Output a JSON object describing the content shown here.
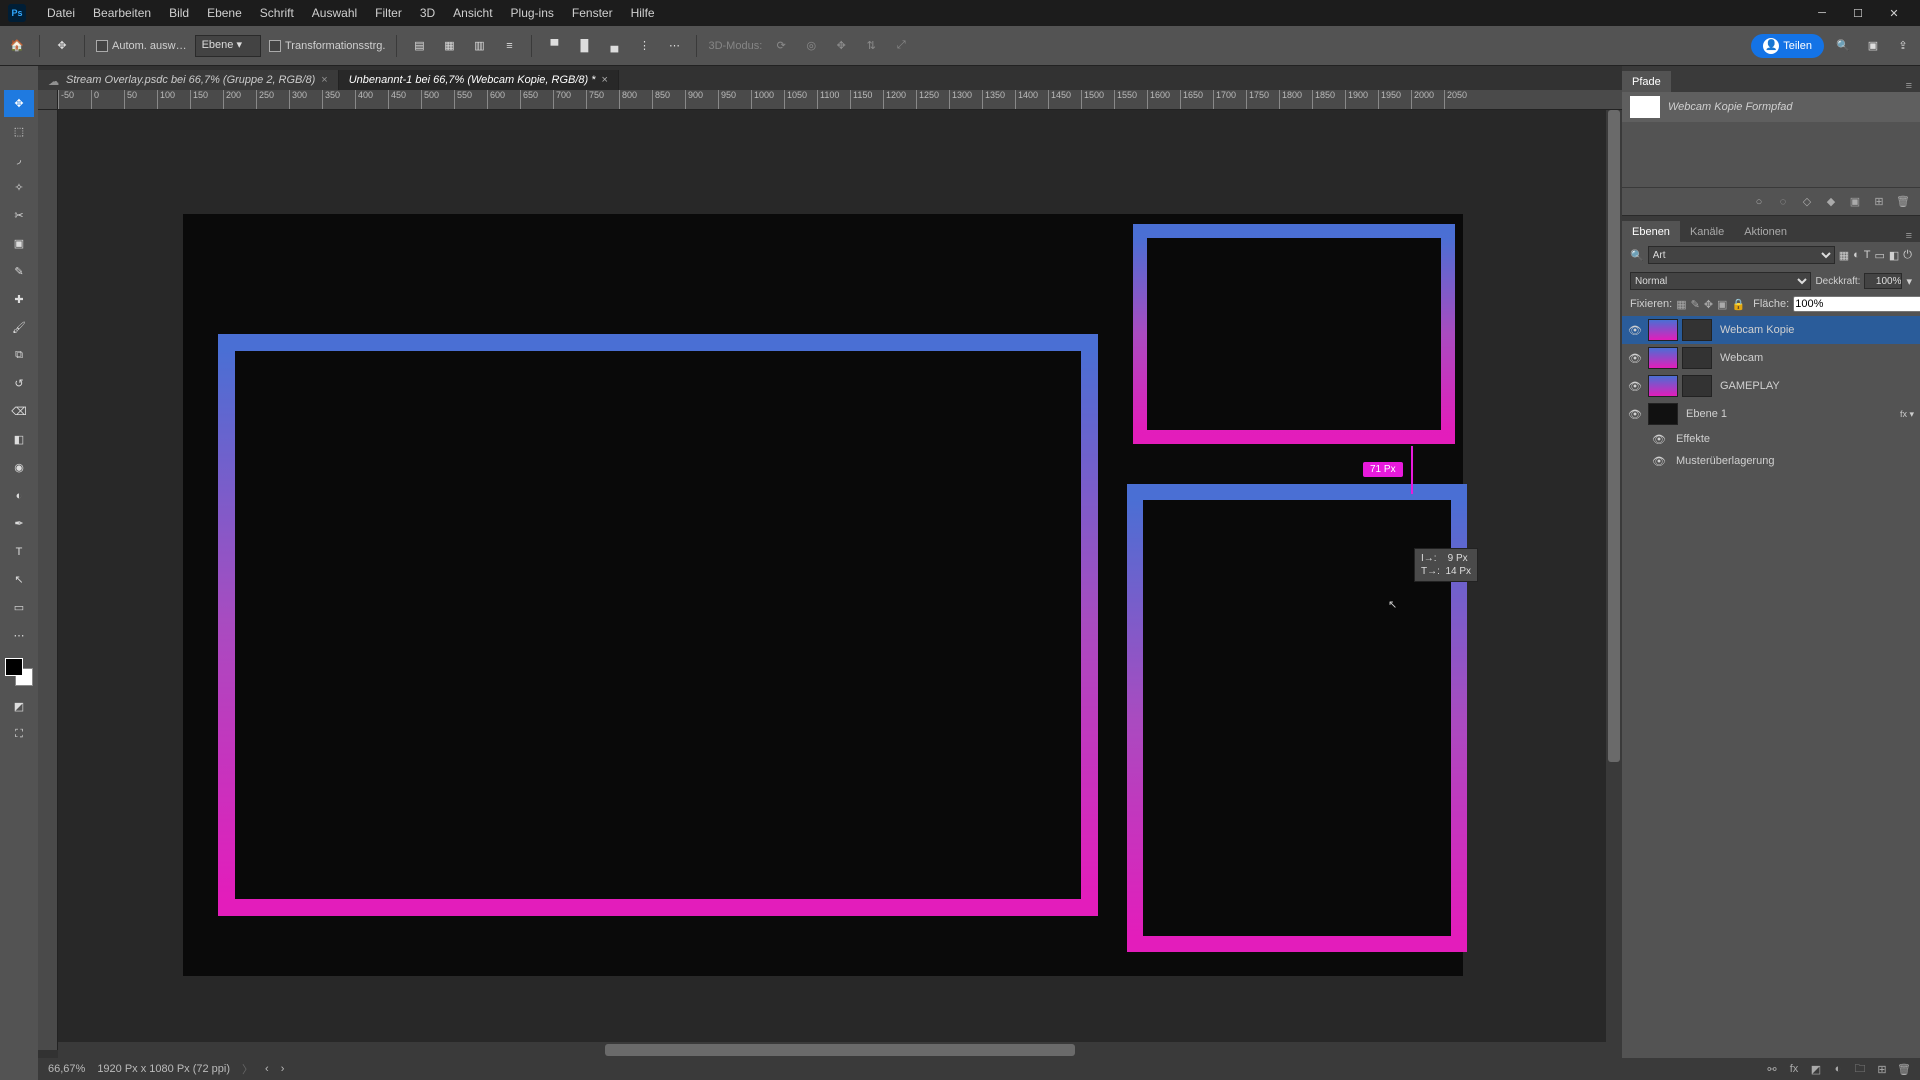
{
  "app": {
    "logo": "Ps"
  },
  "menu": [
    "Datei",
    "Bearbeiten",
    "Bild",
    "Ebene",
    "Schrift",
    "Auswahl",
    "Filter",
    "3D",
    "Ansicht",
    "Plug-ins",
    "Fenster",
    "Hilfe"
  ],
  "options": {
    "auto_select_label": "Autom. ausw…",
    "target_dropdown": "Ebene",
    "transform_label": "Transformationsstrg.",
    "mode_3d": "3D-Modus:",
    "share_label": "Teilen"
  },
  "tabs": [
    {
      "title": "Stream Overlay.psdc bei 66,7% (Gruppe 2, RGB/8)",
      "active": false,
      "cloud": true
    },
    {
      "title": "Unbenannt-1 bei 66,7% (Webcam Kopie, RGB/8) *",
      "active": true,
      "cloud": false
    }
  ],
  "ruler_values": [
    "-50",
    "0",
    "50",
    "100",
    "150",
    "200",
    "250",
    "300",
    "350",
    "400",
    "450",
    "500",
    "550",
    "600",
    "650",
    "700",
    "750",
    "800",
    "850",
    "900",
    "950",
    "1000",
    "1050",
    "1100",
    "1150",
    "1200",
    "1250",
    "1300",
    "1350",
    "1400",
    "1450",
    "1500",
    "1550",
    "1600",
    "1650",
    "1700",
    "1750",
    "1800",
    "1850",
    "1900",
    "1950",
    "2000",
    "2050"
  ],
  "canvas": {
    "measure_badge": "71 Px",
    "cursor_info": "I→:    9 Px\nT→:  14 Px"
  },
  "paths_panel": {
    "tab": "Pfade",
    "item": "Webcam Kopie Formpfad"
  },
  "layers_panel": {
    "tabs": [
      "Ebenen",
      "Kanäle",
      "Aktionen"
    ],
    "active_tab": 0,
    "search_placeholder": "Art",
    "blend_mode": "Normal",
    "opacity_label": "Deckkraft:",
    "opacity_value": "100%",
    "lock_label": "Fixieren:",
    "fill_label": "Fläche:",
    "fill_value": "100%",
    "layers": [
      {
        "name": "Webcam Kopie",
        "selected": true,
        "shape": true,
        "visible": true
      },
      {
        "name": "Webcam",
        "selected": false,
        "shape": true,
        "visible": true
      },
      {
        "name": "GAMEPLAY",
        "selected": false,
        "shape": true,
        "visible": true
      },
      {
        "name": "Ebene 1",
        "selected": false,
        "shape": false,
        "visible": true,
        "fx": true
      }
    ],
    "effects_label": "Effekte",
    "effect_1": "Musterüberlagerung"
  },
  "status": {
    "zoom": "66,67%",
    "doc_info": "1920 Px x 1080 Px (72 ppi)"
  }
}
